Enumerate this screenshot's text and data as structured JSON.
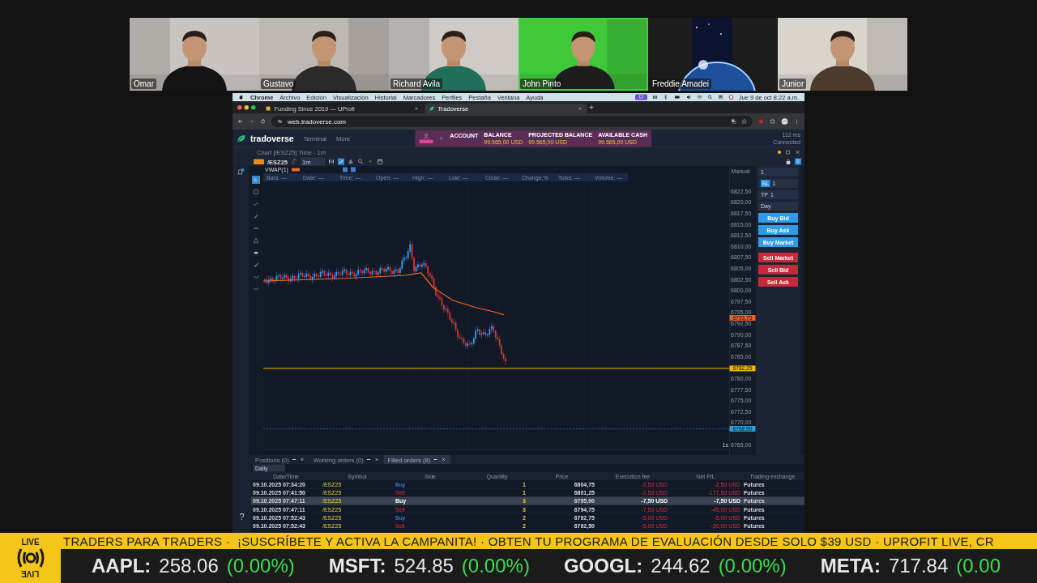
{
  "participants": [
    {
      "name": "Omar",
      "kind": "camera",
      "speaking": false
    },
    {
      "name": "Gustavo",
      "kind": "camera",
      "speaking": false
    },
    {
      "name": "Richard Avila",
      "kind": "camera",
      "speaking": false
    },
    {
      "name": "John Pinto",
      "kind": "camera",
      "speaking": true
    },
    {
      "name": "Freddie Amadei",
      "speaking": false
    },
    {
      "name": "Junior",
      "kind": "camera",
      "speaking": false
    }
  ],
  "shared_screen": {
    "menubar": {
      "items": [
        "Chrome",
        "Archivo",
        "Edición",
        "Visualización",
        "Historial",
        "Marcadores",
        "Perfiles",
        "Pestaña",
        "Ventana",
        "Ayuda"
      ],
      "clock": "Jue 9 de oct 8:22 a.m."
    },
    "browser": {
      "tabs": [
        {
          "title": "Funding Since 2019 — UProfi",
          "selected": false
        },
        {
          "title": "Tradoverse",
          "selected": true
        }
      ],
      "url": "web.tradoverse.com"
    },
    "app": {
      "logo": "tradoverse",
      "nav": [
        "Terminal",
        "More"
      ],
      "account_label": "ACCOUNT",
      "stats": [
        {
          "label": "BALANCE",
          "value": "99.565,00 USD"
        },
        {
          "label": "PROJECTED BALANCE",
          "value": "99.565,00 USD"
        },
        {
          "label": "AVAILABLE CASH",
          "value": "99.565,00 USD"
        }
      ],
      "latency": "112 ms",
      "connection": "Connected"
    },
    "chart": {
      "title": "Chart [/ESZ25] Time - 1m",
      "symbol": "/ESZ25",
      "interval": "1m",
      "indicator": "VWAP(1)",
      "info": [
        {
          "label": "Bars:",
          "value": "—"
        },
        {
          "label": "Date:",
          "value": "—"
        },
        {
          "label": "Time:",
          "value": "—"
        },
        {
          "label": "Open:",
          "value": "—"
        },
        {
          "label": "High:",
          "value": "—"
        },
        {
          "label": "Low:",
          "value": "—"
        },
        {
          "label": "Close:",
          "value": "—"
        },
        {
          "label": "Change,%"
        },
        {
          "label": "Ticks:",
          "value": "—"
        },
        {
          "label": "Volume:",
          "value": "—"
        }
      ],
      "axis_mode": "Manual",
      "price_axis": [
        [
          "6822,50",
          "6820,00",
          "6817,50",
          "6815,00",
          "6812,50",
          "6810,00",
          "6807,50",
          "6805,00",
          "6802,50",
          "6800,00",
          "6797,50",
          "6795,00",
          "6792,50",
          "6790,00",
          "6787,50",
          "6785,00"
        ],
        [
          "6780,00",
          "6777,50",
          "6775,00",
          "6772,50",
          "6770,00"
        ],
        [
          "6765,00"
        ]
      ],
      "markers": [
        {
          "text": "6793,75",
          "color": "#e8641e",
          "level": 0.5
        },
        {
          "text": "6782,25",
          "color": "#f2b705",
          "level": 0.3
        },
        {
          "text": "6768,50",
          "color": "#2a9ee0",
          "level": 0.061
        }
      ],
      "scale_label": "1s"
    },
    "order_panel": {
      "quantity": "1",
      "sl_label": "SL",
      "sl": "1",
      "tp_label": "TP",
      "tp": "1",
      "time_in_force": "Day",
      "buttons": [
        {
          "label": "Buy Bid",
          "kind": "buy"
        },
        {
          "label": "Buy Ask",
          "kind": "buy"
        },
        {
          "label": "Buy Market",
          "kind": "buy"
        },
        {
          "label": "Sell Market",
          "kind": "sell"
        },
        {
          "label": "Sell Bid",
          "kind": "sell"
        },
        {
          "label": "Sell Ask",
          "kind": "sell"
        }
      ]
    },
    "help": "?",
    "orders": {
      "tabs": [
        {
          "label": "Positions",
          "count": "(0)",
          "selected": false
        },
        {
          "label": "Working orders",
          "count": "(0)",
          "selected": false
        },
        {
          "label": "Filled orders",
          "count": "(8)",
          "selected": true
        }
      ],
      "period": "Daily",
      "columns": [
        "Date/Time",
        "Symbol",
        "Side",
        "Quantity",
        "Price",
        "Execution fee",
        "Net P/L",
        "Trading exchange"
      ],
      "rows": [
        {
          "time": "09.10.2025  07:34:20",
          "symbol": "/ESZ25",
          "side": "Buy",
          "kind": "buy",
          "quantity": "1",
          "price": "6804,75",
          "fee": "-2,50 USD",
          "pl": "-2,50 USD",
          "exchange": "Futures",
          "selected": false
        },
        {
          "time": "09.10.2025  07:41:50",
          "symbol": "/ESZ25",
          "side": "Sell",
          "kind": "sell",
          "quantity": "1",
          "price": "6801,25",
          "fee": "-2,50 USD",
          "pl": "-177,50 USD",
          "exchange": "Futures",
          "selected": false
        },
        {
          "time": "09.10.2025  07:47:11",
          "symbol": "/ESZ25",
          "side": "Buy",
          "kind": "buy",
          "quantity": "3",
          "price": "6795,00",
          "fee": "-7,50 USD",
          "pl": "-7,50 USD",
          "exchange": "Futures",
          "selected": true
        },
        {
          "time": "09.10.2025  07:47:11",
          "symbol": "/ESZ25",
          "side": "Sell",
          "kind": "sell",
          "quantity": "3",
          "price": "6794,75",
          "fee": "-7,50 USD",
          "pl": "-45,00 USD",
          "exchange": "Futures",
          "selected": false
        },
        {
          "time": "09.10.2025  07:52:43",
          "symbol": "/ESZ25",
          "side": "Buy",
          "kind": "buy",
          "quantity": "2",
          "price": "6792,75",
          "fee": "-5,00 USD",
          "pl": "-5,00 USD",
          "exchange": "Futures",
          "selected": false
        },
        {
          "time": "09.10.2025  07:52:43",
          "symbol": "/ESZ25",
          "side": "Sell",
          "kind": "sell",
          "quantity": "2",
          "price": "6792,50",
          "fee": "-5,00 USD",
          "pl": "-30,00 USD",
          "exchange": "Futures",
          "selected": false
        }
      ]
    }
  },
  "ticker": {
    "logo_text": [
      "LIVE",
      "LIVE"
    ],
    "message": "TRADERS PARA TRADERS ·  ¡SUSCRÍBETE Y ACTIVA LA CAMPANITA! · OBTEN TU PROGRAMA DE EVALUACIÓN DESDE SOLO $39 USD · UPROFIT LIVE, CR",
    "quotes": [
      {
        "symbol": "AAPL:",
        "price": "258.06",
        "change": "(0.00%)"
      },
      {
        "symbol": "MSFT:",
        "price": "524.85",
        "change": "(0.00%)"
      },
      {
        "symbol": "GOOGL:",
        "price": "244.62",
        "change": "(0.00%)"
      },
      {
        "symbol": "META:",
        "price": "717.84",
        "change": "(0.00"
      }
    ]
  }
}
